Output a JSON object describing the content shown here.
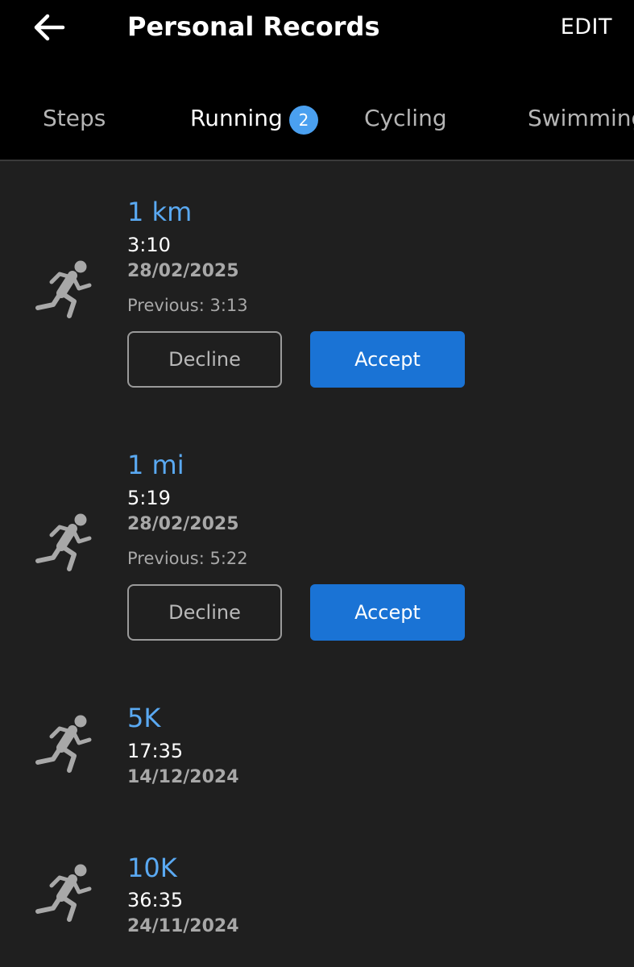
{
  "header": {
    "title": "Personal Records",
    "edit_label": "EDIT",
    "back_icon": "arrow-left-icon"
  },
  "tabs": [
    {
      "label": "Steps",
      "active": false
    },
    {
      "label": "Running",
      "active": true,
      "badge": "2"
    },
    {
      "label": "Cycling",
      "active": false
    },
    {
      "label": "Swimming",
      "active": false
    }
  ],
  "records": [
    {
      "title": "1 km",
      "time": "3:10",
      "date": "28/02/2025",
      "previous": "Previous: 3:13",
      "decline_label": "Decline",
      "accept_label": "Accept",
      "icon": "runner-icon"
    },
    {
      "title": "1 mi",
      "time": "5:19",
      "date": "28/02/2025",
      "previous": "Previous: 5:22",
      "decline_label": "Decline",
      "accept_label": "Accept",
      "icon": "runner-icon"
    },
    {
      "title": "5K",
      "time": "17:35",
      "date": "14/12/2024",
      "icon": "runner-icon"
    },
    {
      "title": "10K",
      "time": "36:35",
      "date": "24/11/2024",
      "icon": "runner-icon"
    }
  ],
  "colors": {
    "background": "#1f1f1f",
    "header_background": "#000000",
    "accent": "#5aa9f2",
    "accept_button": "#1a73d5",
    "badge": "#4aa0f0"
  }
}
